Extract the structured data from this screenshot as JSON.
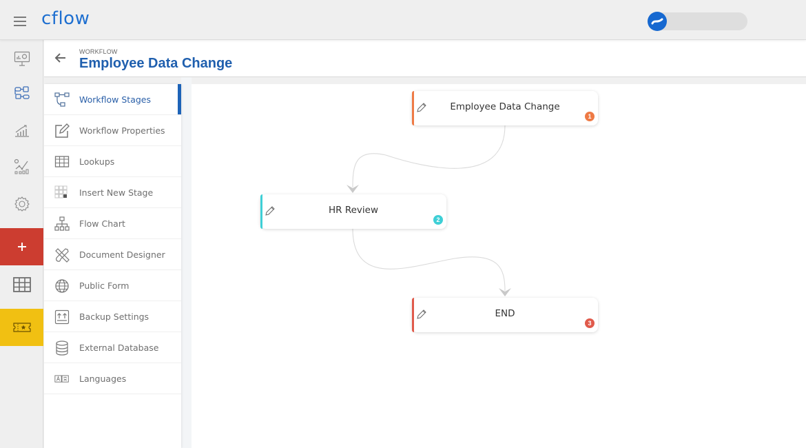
{
  "app": {
    "logo_text": "cflow",
    "menu_icon": "hamburger-icon",
    "user_avatar_icon": "cflow-wave-avatar-icon"
  },
  "rail": {
    "items": [
      {
        "name": "dashboard",
        "icon": "monitor-chart-icon"
      },
      {
        "name": "workflows",
        "icon": "workflow-diagram-icon"
      },
      {
        "name": "reports",
        "icon": "growth-bar-chart-icon"
      },
      {
        "name": "analytics",
        "icon": "analytics-line-chart-icon"
      },
      {
        "name": "settings",
        "icon": "gear-icon"
      },
      {
        "name": "create",
        "icon": "plus-icon",
        "color": "#cc3d30"
      },
      {
        "name": "tables",
        "icon": "grid-table-icon"
      },
      {
        "name": "rewards",
        "icon": "ticket-star-icon",
        "color": "#f1c012"
      }
    ]
  },
  "header": {
    "breadcrumb": "WORKFLOW",
    "title": "Employee Data Change",
    "back_icon": "arrow-left-icon"
  },
  "submenu": {
    "active_index": 0,
    "items": [
      {
        "label": "Workflow Stages",
        "icon": "workflow-stages-icon"
      },
      {
        "label": "Workflow Properties",
        "icon": "edit-square-icon"
      },
      {
        "label": "Lookups",
        "icon": "table-icon"
      },
      {
        "label": "Insert New Stage",
        "icon": "insert-grid-icon"
      },
      {
        "label": "Flow Chart",
        "icon": "org-chart-icon"
      },
      {
        "label": "Document Designer",
        "icon": "design-tools-icon"
      },
      {
        "label": "Public Form",
        "icon": "globe-icon"
      },
      {
        "label": "Backup Settings",
        "icon": "backup-upload-icon"
      },
      {
        "label": "External Database",
        "icon": "database-icon"
      },
      {
        "label": "Languages",
        "icon": "language-translate-icon"
      }
    ]
  },
  "workflow": {
    "stages": [
      {
        "label": "Employee Data Change",
        "number": "1",
        "color": "#ee7a45"
      },
      {
        "label": "HR Review",
        "number": "2",
        "color": "#3ecfd6"
      },
      {
        "label": "END",
        "number": "3",
        "color": "#e05a4b"
      }
    ],
    "connections": [
      {
        "from": "1",
        "to": "2"
      },
      {
        "from": "2",
        "to": "3"
      }
    ]
  }
}
